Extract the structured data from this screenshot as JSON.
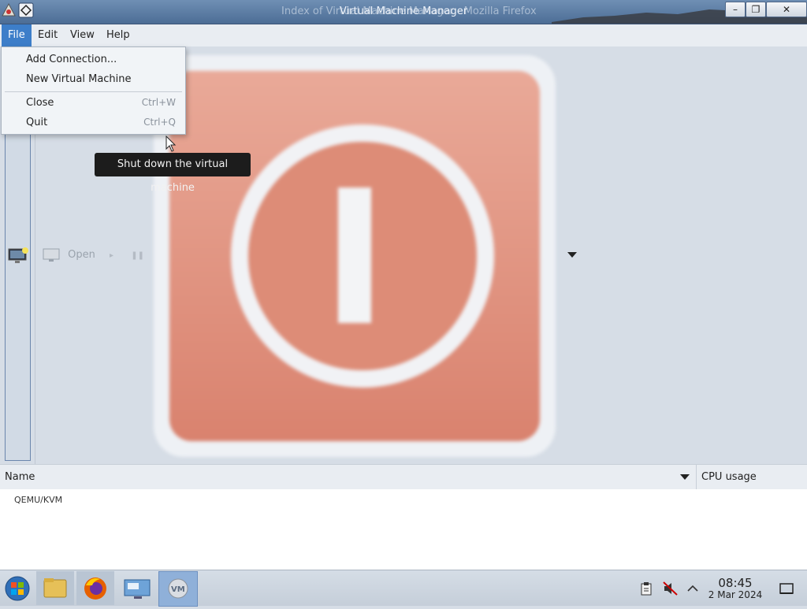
{
  "window": {
    "title": "Virtual Machine Manager",
    "background_title": "Index of Virtual Machine Manager - Mozilla Firefox",
    "controls": {
      "minimize": "–",
      "maximize": "❐",
      "close": "✕"
    }
  },
  "menubar": {
    "items": [
      {
        "label": "File"
      },
      {
        "label": "Edit"
      },
      {
        "label": "View"
      },
      {
        "label": "Help"
      }
    ]
  },
  "file_menu": {
    "items": [
      {
        "label": "Add Connection...",
        "shortcut": ""
      },
      {
        "label": "New Virtual Machine",
        "shortcut": ""
      },
      {
        "label": "Close",
        "shortcut": "Ctrl+W"
      },
      {
        "label": "Quit",
        "shortcut": "Ctrl+Q"
      }
    ]
  },
  "toolbar": {
    "open_label": "Open"
  },
  "tooltip": {
    "text": "Shut down the virtual machine"
  },
  "table": {
    "columns": {
      "name": "Name",
      "cpu": "CPU usage"
    },
    "rows": [
      {
        "name": "QEMU/KVM"
      }
    ]
  },
  "taskbar": {
    "apps": [
      "start-orb-icon",
      "file-manager-icon",
      "firefox-icon",
      "remote-desktop-icon",
      "virt-manager-icon"
    ],
    "clock": {
      "time": "08:45",
      "date": "2 Mar 2024"
    }
  },
  "colors": {
    "accent": "#3d7ec9",
    "power_icon": "#d9826e",
    "titlebar": "#4c6d95"
  }
}
